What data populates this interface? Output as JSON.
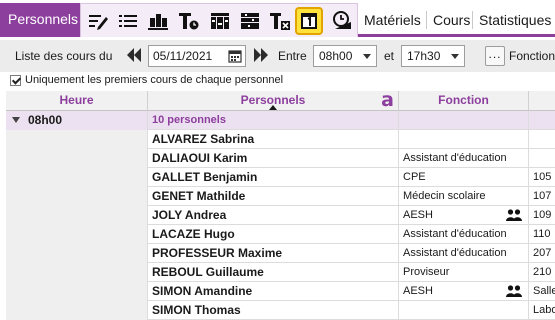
{
  "tabs": {
    "active": "Personnels",
    "others": [
      "Matériels",
      "Cours",
      "Statistiques"
    ]
  },
  "tools": [
    {
      "icon": "edit-list-icon"
    },
    {
      "icon": "list-icon"
    },
    {
      "icon": "people-group-icon"
    },
    {
      "icon": "timetable-icon"
    },
    {
      "icon": "grid-columns-icon"
    },
    {
      "icon": "grid-rows-icon"
    },
    {
      "icon": "timetable-remove-icon"
    },
    {
      "icon": "day-calendar-icon",
      "selected": true
    },
    {
      "icon": "clock-icon"
    }
  ],
  "filters": {
    "label": "Liste des cours du",
    "date": "05/11/2021",
    "between_label": "Entre",
    "start": "08h00",
    "and_label": "et",
    "end": "17h30",
    "more_label": "...",
    "function_label": "Fonction"
  },
  "checkbox": {
    "label": "Uniquement les premiers cours de chaque personnel",
    "checked": true
  },
  "columns": {
    "heure": "Heure",
    "personnels": "Personnels",
    "fonction": "Fonction"
  },
  "group": {
    "time": "08h00",
    "count": "10 personnels"
  },
  "rows": [
    {
      "name": "ALVAREZ Sabrina",
      "fonction": "",
      "salle": "",
      "group_icon": false
    },
    {
      "name": "DALIAOUI Karim",
      "fonction": "Assistant d'éducation",
      "salle": "",
      "group_icon": false
    },
    {
      "name": "GALLET Benjamin",
      "fonction": "CPE",
      "salle": "105",
      "group_icon": false
    },
    {
      "name": "GENET Mathilde",
      "fonction": "Médecin scolaire",
      "salle": "107",
      "group_icon": false
    },
    {
      "name": "JOLY Andrea",
      "fonction": "AESH",
      "salle": "109",
      "group_icon": true
    },
    {
      "name": "LACAZE Hugo",
      "fonction": "Assistant d'éducation",
      "salle": "110",
      "group_icon": false
    },
    {
      "name": "PROFESSEUR Maxime",
      "fonction": "Assistant d'éducation",
      "salle": "207",
      "group_icon": false
    },
    {
      "name": "REBOUL Guillaume",
      "fonction": "Proviseur",
      "salle": "210",
      "group_icon": false
    },
    {
      "name": "SIMON Amandine",
      "fonction": "AESH",
      "salle": "Salle",
      "group_icon": true
    },
    {
      "name": "SIMON Thomas",
      "fonction": "",
      "salle": "Labo",
      "group_icon": false
    }
  ],
  "colors": {
    "accent": "#8d3f9e",
    "selected_tool": "#ffe23b",
    "group_row": "#ece1f0"
  }
}
